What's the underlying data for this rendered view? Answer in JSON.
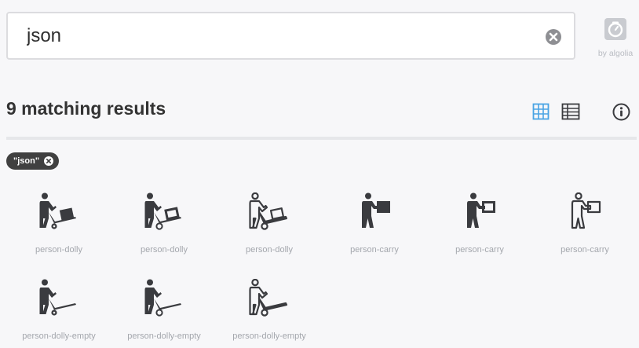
{
  "search": {
    "value": "json",
    "placeholder": ""
  },
  "algolia": {
    "label": "by algolia"
  },
  "results": {
    "title": "9 matching results"
  },
  "filter_chip": {
    "label": "\"json\""
  },
  "icons": [
    {
      "label": "person-dolly",
      "icon": "person-dolly-icon"
    },
    {
      "label": "person-dolly",
      "icon": "person-dolly-icon"
    },
    {
      "label": "person-dolly",
      "icon": "person-dolly-icon"
    },
    {
      "label": "person-carry",
      "icon": "person-carry-icon"
    },
    {
      "label": "person-carry",
      "icon": "person-carry-icon"
    },
    {
      "label": "person-carry",
      "icon": "person-carry-icon"
    },
    {
      "label": "person-dolly-empty",
      "icon": "person-dolly-empty-icon"
    },
    {
      "label": "person-dolly-empty",
      "icon": "person-dolly-empty-icon"
    },
    {
      "label": "person-dolly-empty",
      "icon": "person-dolly-empty-icon"
    }
  ],
  "colors": {
    "accent": "#4aa4e4",
    "icon": "#3a3b3f",
    "label": "#a4a7ad",
    "chip": "#404040"
  }
}
